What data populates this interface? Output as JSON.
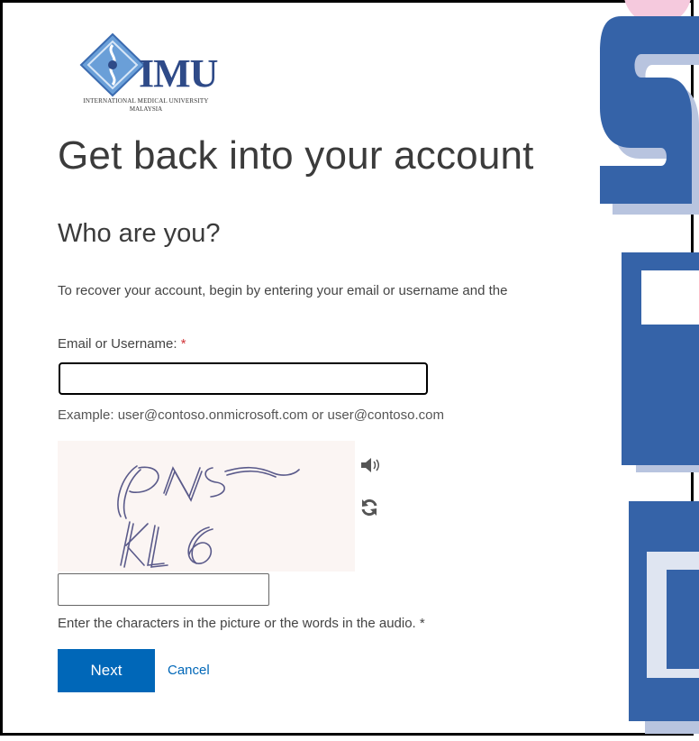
{
  "logo": {
    "name": "IMU",
    "subtitle_line1": "INTERNATIONAL MEDICAL UNIVERSITY",
    "subtitle_line2": "MALAYSIA"
  },
  "page": {
    "title": "Get back into your account",
    "subtitle": "Who are you?",
    "intro": "To recover your account, begin by entering your email or username and the"
  },
  "email_field": {
    "label": "Email or Username:",
    "required_mark": "*",
    "value": "",
    "example": "Example: user@contoso.onmicrosoft.com or user@contoso.com"
  },
  "captcha": {
    "hint": "Enter the characters in the picture or the words in the audio. *",
    "value": "",
    "audio_icon": "speaker-icon",
    "refresh_icon": "refresh-icon"
  },
  "actions": {
    "next_label": "Next",
    "cancel_label": "Cancel"
  },
  "colors": {
    "accent": "#0067b8",
    "required": "#d13438",
    "overlay_blue": "#3563a8",
    "overlay_shadow": "#b8c4df",
    "overlay_pink": "#f5c9dd"
  }
}
